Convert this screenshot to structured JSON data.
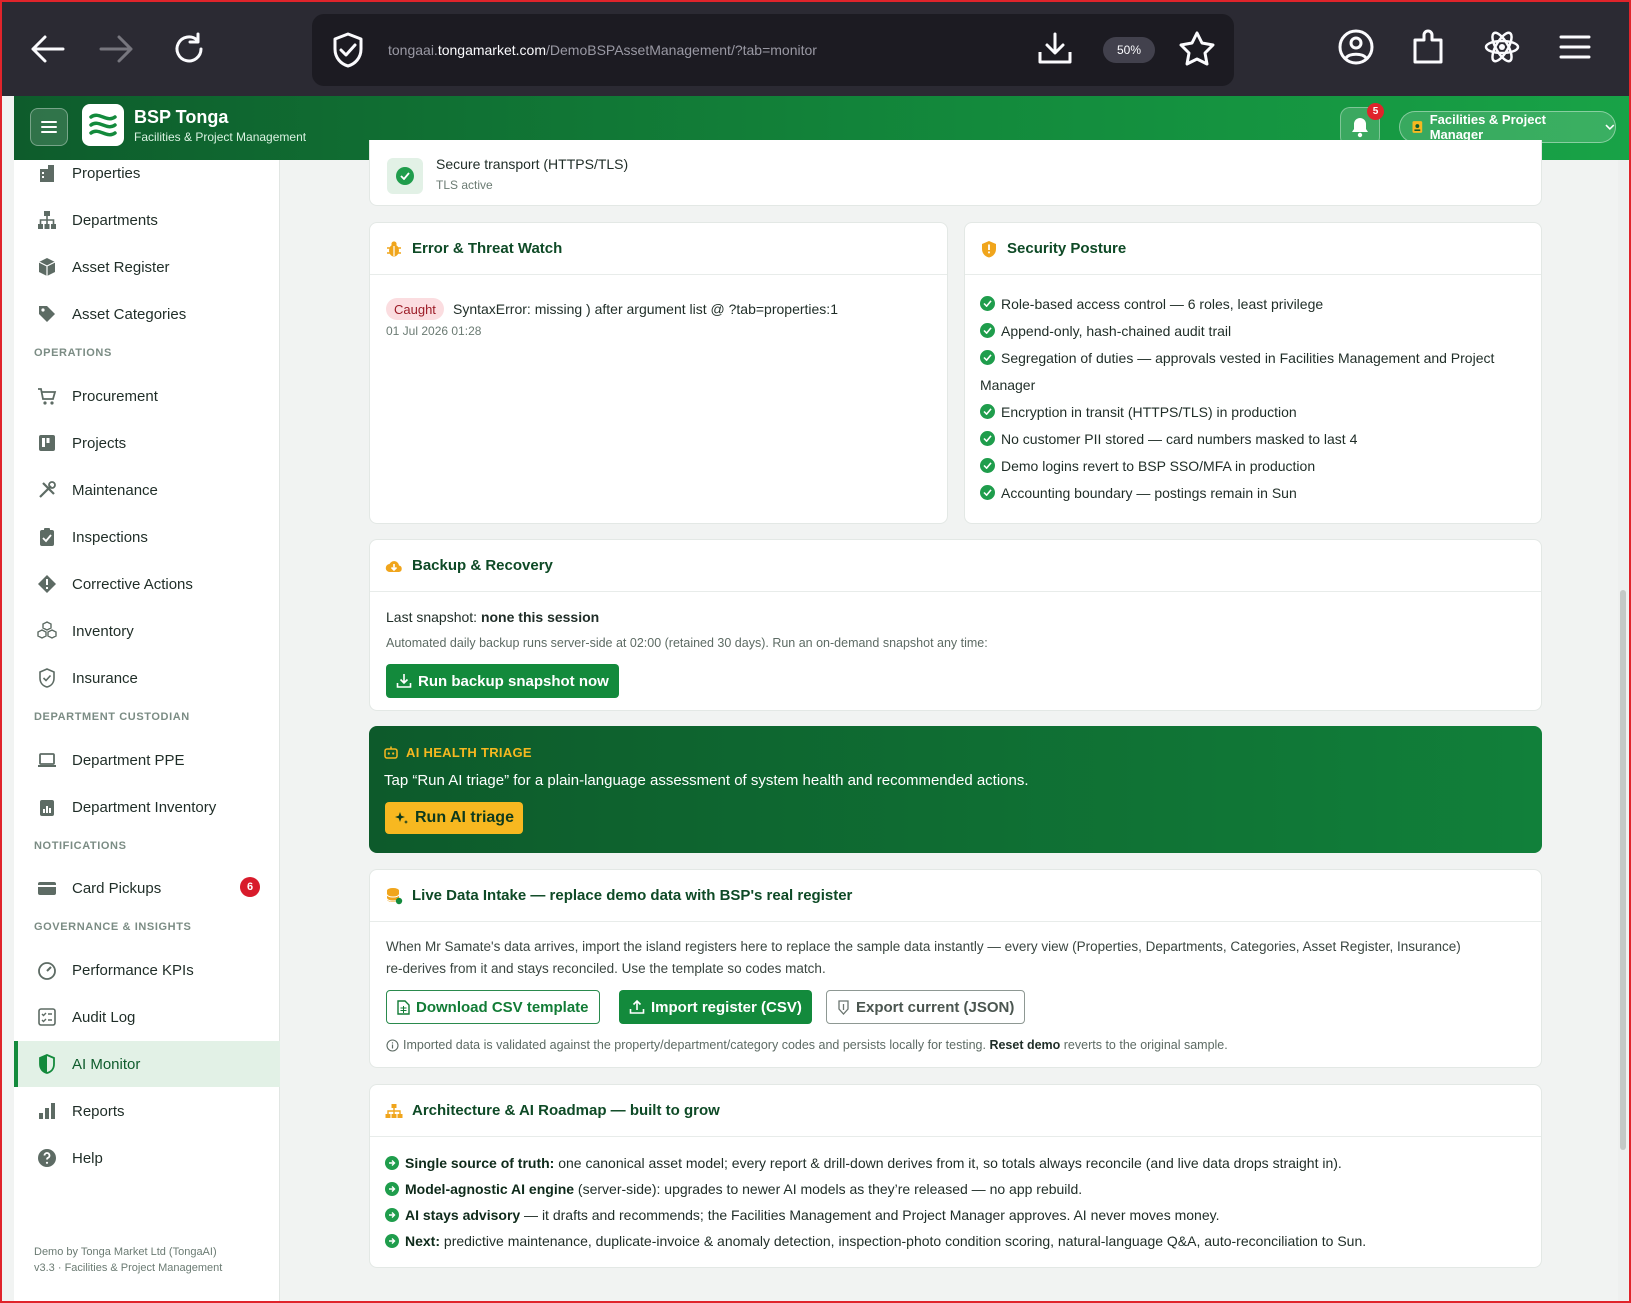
{
  "browser": {
    "url_prefix": "tongaai.",
    "url_domain": "tongamarket.com",
    "url_path": "/DemoBSPAssetManagement/?tab=monitor",
    "zoom": "50%"
  },
  "header": {
    "brand_title": "BSP Tonga",
    "brand_subtitle": "Facilities & Project Management",
    "notification_count": "5",
    "role_label": "Facilities & Project Manager"
  },
  "sidebar": {
    "items_top": [
      {
        "label": "Properties",
        "icon": "building-icon"
      },
      {
        "label": "Departments",
        "icon": "org-chart-icon"
      },
      {
        "label": "Asset Register",
        "icon": "box-icon"
      },
      {
        "label": "Asset Categories",
        "icon": "tag-icon"
      }
    ],
    "section_operations": "OPERATIONS",
    "items_operations": [
      {
        "label": "Procurement",
        "icon": "cart-icon"
      },
      {
        "label": "Projects",
        "icon": "kanban-icon"
      },
      {
        "label": "Maintenance",
        "icon": "tools-icon"
      },
      {
        "label": "Inspections",
        "icon": "clipboard-check-icon"
      },
      {
        "label": "Corrective Actions",
        "icon": "diamond-alert-icon"
      },
      {
        "label": "Inventory",
        "icon": "boxes-icon"
      },
      {
        "label": "Insurance",
        "icon": "shield-check-icon"
      }
    ],
    "section_custodian": "DEPARTMENT CUSTODIAN",
    "items_custodian": [
      {
        "label": "Department PPE",
        "icon": "laptop-icon"
      },
      {
        "label": "Department Inventory",
        "icon": "clipboard-data-icon"
      }
    ],
    "section_notifications": "NOTIFICATIONS",
    "items_notifications": [
      {
        "label": "Card Pickups",
        "icon": "card-icon",
        "badge": "6"
      }
    ],
    "section_governance": "GOVERNANCE & INSIGHTS",
    "items_governance": [
      {
        "label": "Performance KPIs",
        "icon": "speedometer-icon"
      },
      {
        "label": "Audit Log",
        "icon": "checklist-icon"
      },
      {
        "label": "AI Monitor",
        "icon": "shield-half-icon",
        "active": true
      },
      {
        "label": "Reports",
        "icon": "bar-chart-icon"
      },
      {
        "label": "Help",
        "icon": "help-icon"
      }
    ],
    "footer_line1": "Demo by Tonga Market Ltd (TongaAI)",
    "footer_line2": "v3.3 · Facilities & Project Management"
  },
  "transport": {
    "title": "Secure transport (HTTPS/TLS)",
    "status": "TLS active"
  },
  "error_watch": {
    "title": "Error & Threat Watch",
    "badge": "Caught",
    "message": "SyntaxError: missing ) after argument list @ ?tab=properties:1",
    "timestamp": "01 Jul 2026 01:28"
  },
  "security": {
    "title": "Security Posture",
    "items": [
      "Role-based access control — 6 roles, least privilege",
      "Append-only, hash-chained audit trail",
      "Segregation of duties — approvals vested in Facilities Management and Project",
      "Encryption in transit (HTTPS/TLS) in production",
      "No customer PII stored — card numbers masked to last 4",
      "Demo logins revert to BSP SSO/MFA in production",
      "Accounting boundary — postings remain in Sun"
    ],
    "wrap_text": "Manager"
  },
  "backup": {
    "title": "Backup & Recovery",
    "snapshot_label": "Last snapshot: ",
    "snapshot_value": "none this session",
    "description": "Automated daily backup runs server-side at 02:00 (retained 30 days). Run an on-demand snapshot any time:",
    "button": "Run backup snapshot now"
  },
  "ai_triage": {
    "title": "AI HEALTH TRIAGE",
    "description": "Tap “Run AI triage” for a plain-language assessment of system health and recommended actions.",
    "button": "Run AI triage"
  },
  "intake": {
    "title": "Live Data Intake — replace demo data with BSP's real register",
    "line1": "When Mr Samate's data arrives, import the island registers here to replace the sample data instantly — every view (Properties, Departments, Categories, Asset Register, Insurance)",
    "line2": "re-derives from it and stays reconciled. Use the template so codes match.",
    "btn_template": "Download CSV template",
    "btn_import": "Import register (CSV)",
    "btn_export": "Export current (JSON)",
    "note_pre": "Imported data is validated against the property/department/category codes and persists locally for testing. ",
    "note_bold": "Reset demo",
    "note_post": " reverts to the original sample."
  },
  "roadmap": {
    "title": "Architecture & AI Roadmap — built to grow",
    "items": [
      {
        "bold": "Single source of truth:",
        "text": " one canonical asset model; every report & drill-down derives from it, so totals always reconcile (and live data drops straight in)."
      },
      {
        "bold": "Model-agnostic AI engine",
        "text": " (server-side): upgrades to newer AI models as they’re released — no app rebuild."
      },
      {
        "bold": "AI stays advisory",
        "text": " — it drafts and recommends; the Facilities Management and Project Manager approves. AI never moves money."
      },
      {
        "bold": "Next:",
        "text": " predictive maintenance, duplicate-invoice & anomaly detection, inspection-photo condition scoring, natural-language Q&A, auto-reconciliation to Sun."
      }
    ]
  },
  "colors": {
    "brand_green": "#138a3c",
    "dark_green": "#0e5c2c",
    "accent_gold": "#f7b820",
    "alert_red": "#d81b2b"
  }
}
